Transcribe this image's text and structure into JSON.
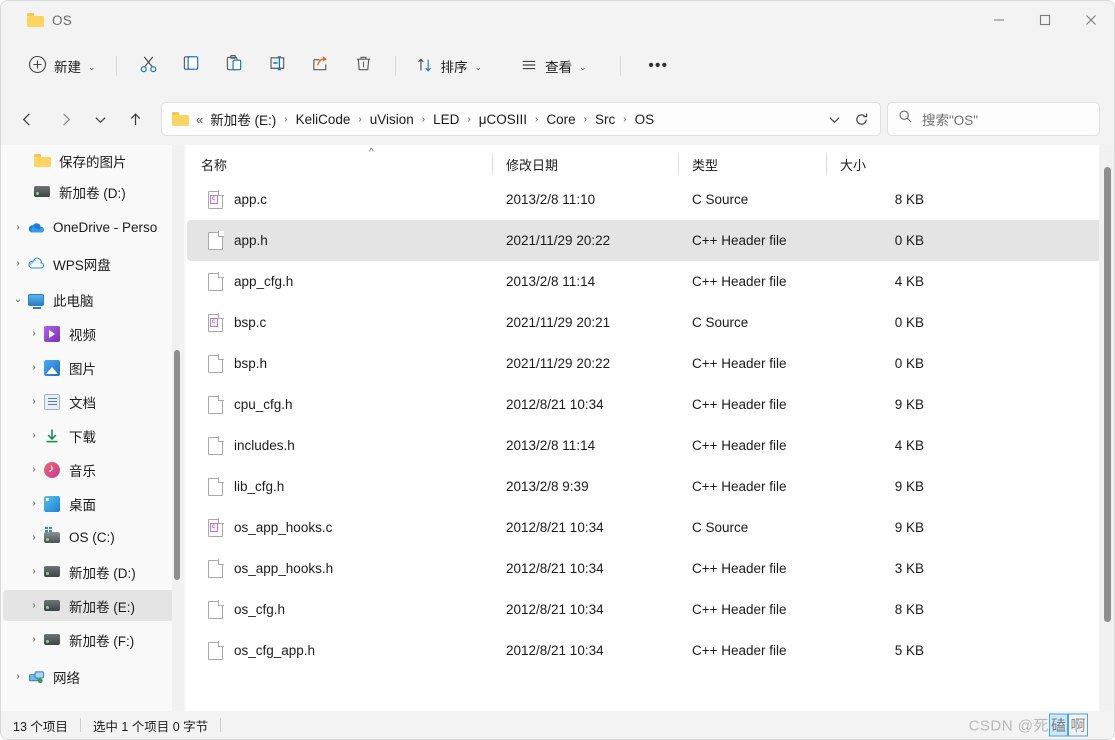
{
  "window": {
    "title": "OS",
    "controls": {
      "minimize": "minimize-button",
      "maximize": "maximize-button",
      "close": "close-button"
    }
  },
  "toolbar": {
    "new_label": "新建",
    "sort_label": "排序",
    "view_label": "查看",
    "more_label": "•••",
    "icons": [
      "cut-icon",
      "copy-icon",
      "paste-icon",
      "rename-icon",
      "share-icon",
      "delete-icon"
    ]
  },
  "address": {
    "back": "back-button",
    "forward": "forward-button",
    "recent": "recent-locations-button",
    "up": "up-button",
    "refresh": "refresh-button",
    "overflow": "«",
    "crumbs": [
      "新加卷 (E:)",
      "KeliCode",
      "uVision",
      "LED",
      "μCOSIII",
      "Core",
      "Src",
      "OS"
    ],
    "separator": "›"
  },
  "search": {
    "placeholder": "搜索\"OS\"",
    "icon": "search-icon"
  },
  "sidebar": {
    "items": [
      {
        "label": "保存的图片",
        "icon": "folder-icon",
        "expander": "",
        "indent": 2,
        "selected": false
      },
      {
        "label": "新加卷 (D:)",
        "icon": "drive-icon",
        "expander": "",
        "indent": 2,
        "selected": false
      },
      {
        "label": "OneDrive - Perso",
        "icon": "onedrive-icon",
        "expander": "›",
        "indent": 0,
        "selected": false
      },
      {
        "label": "WPS网盘",
        "icon": "wps-cloud-icon",
        "expander": "›",
        "indent": 0,
        "selected": false
      },
      {
        "label": "此电脑",
        "icon": "this-pc-icon",
        "expander": "⌄",
        "indent": 0,
        "selected": false
      },
      {
        "label": "视频",
        "icon": "videos-icon",
        "expander": "›",
        "indent": 1,
        "selected": false
      },
      {
        "label": "图片",
        "icon": "pictures-icon",
        "expander": "›",
        "indent": 1,
        "selected": false
      },
      {
        "label": "文档",
        "icon": "documents-icon",
        "expander": "›",
        "indent": 1,
        "selected": false
      },
      {
        "label": "下载",
        "icon": "downloads-icon",
        "expander": "›",
        "indent": 1,
        "selected": false
      },
      {
        "label": "音乐",
        "icon": "music-icon",
        "expander": "›",
        "indent": 1,
        "selected": false
      },
      {
        "label": "桌面",
        "icon": "desktop-icon",
        "expander": "›",
        "indent": 1,
        "selected": false
      },
      {
        "label": "OS (C:)",
        "icon": "windows-drive-icon",
        "expander": "›",
        "indent": 1,
        "selected": false
      },
      {
        "label": "新加卷 (D:)",
        "icon": "drive-icon",
        "expander": "›",
        "indent": 1,
        "selected": false
      },
      {
        "label": "新加卷 (E:)",
        "icon": "drive-icon",
        "expander": "›",
        "indent": 1,
        "selected": true
      },
      {
        "label": "新加卷 (F:)",
        "icon": "drive-icon",
        "expander": "›",
        "indent": 1,
        "selected": false
      },
      {
        "label": "网络",
        "icon": "network-icon",
        "expander": "›",
        "indent": 0,
        "selected": false
      }
    ]
  },
  "filelist": {
    "columns": [
      "名称",
      "修改日期",
      "类型",
      "大小"
    ],
    "sort_indicator": "^",
    "rows": [
      {
        "name": "app.c",
        "date": "2013/2/8 11:10",
        "type": "C Source",
        "size": "8 KB",
        "icon": "c-source-file-icon",
        "selected": false
      },
      {
        "name": "app.h",
        "date": "2021/11/29 20:22",
        "type": "C++ Header file",
        "size": "0 KB",
        "icon": "header-file-icon",
        "selected": true
      },
      {
        "name": "app_cfg.h",
        "date": "2013/2/8 11:14",
        "type": "C++ Header file",
        "size": "4 KB",
        "icon": "header-file-icon",
        "selected": false
      },
      {
        "name": "bsp.c",
        "date": "2021/11/29 20:21",
        "type": "C Source",
        "size": "0 KB",
        "icon": "c-source-file-icon",
        "selected": false
      },
      {
        "name": "bsp.h",
        "date": "2021/11/29 20:22",
        "type": "C++ Header file",
        "size": "0 KB",
        "icon": "header-file-icon",
        "selected": false
      },
      {
        "name": "cpu_cfg.h",
        "date": "2012/8/21 10:34",
        "type": "C++ Header file",
        "size": "9 KB",
        "icon": "header-file-icon",
        "selected": false
      },
      {
        "name": "includes.h",
        "date": "2013/2/8 11:14",
        "type": "C++ Header file",
        "size": "4 KB",
        "icon": "header-file-icon",
        "selected": false
      },
      {
        "name": "lib_cfg.h",
        "date": "2013/2/8 9:39",
        "type": "C++ Header file",
        "size": "9 KB",
        "icon": "header-file-icon",
        "selected": false
      },
      {
        "name": "os_app_hooks.c",
        "date": "2012/8/21 10:34",
        "type": "C Source",
        "size": "9 KB",
        "icon": "c-source-file-icon",
        "selected": false
      },
      {
        "name": "os_app_hooks.h",
        "date": "2012/8/21 10:34",
        "type": "C++ Header file",
        "size": "3 KB",
        "icon": "header-file-icon",
        "selected": false
      },
      {
        "name": "os_cfg.h",
        "date": "2012/8/21 10:34",
        "type": "C++ Header file",
        "size": "8 KB",
        "icon": "header-file-icon",
        "selected": false
      },
      {
        "name": "os_cfg_app.h",
        "date": "2012/8/21 10:34",
        "type": "C++ Header file",
        "size": "5 KB",
        "icon": "header-file-icon",
        "selected": false
      }
    ]
  },
  "statusbar": {
    "item_count": "13 个项目",
    "selection": "选中 1 个项目  0 字节"
  },
  "watermark": {
    "prefix": "CSDN @死",
    "highlight": "磕",
    "boxed": "啊"
  },
  "colors": {
    "accent": "#0078d4",
    "window_bg": "#f3f3f3",
    "pane_bg": "#ffffff",
    "selection": "#e4e4e4",
    "folder_yellow": "#fbd461"
  }
}
